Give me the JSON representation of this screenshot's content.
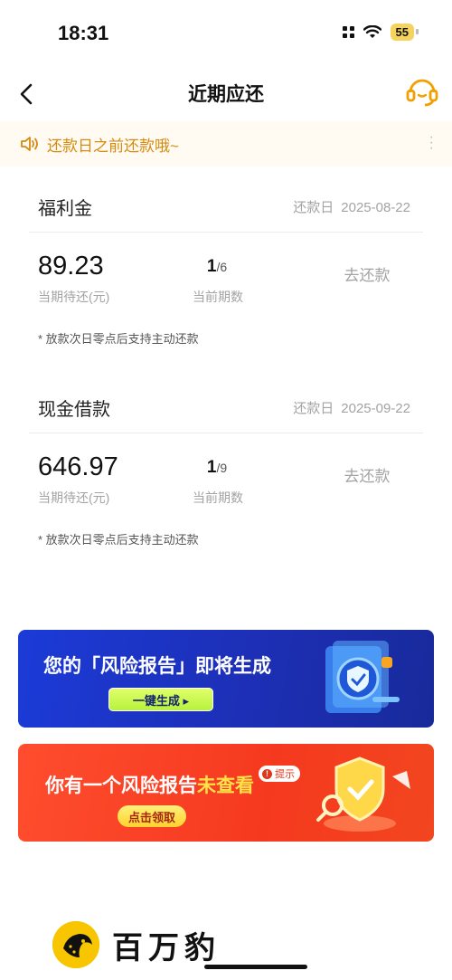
{
  "status_bar": {
    "time": "18:31",
    "battery": "55"
  },
  "nav": {
    "title": "近期应还"
  },
  "notice": {
    "text": "还款日之前还款哦~"
  },
  "loans": [
    {
      "name": "福利金",
      "due_label": "还款日",
      "due_date": "2025-08-22",
      "amount": "89.23",
      "amount_label": "当期待还(元)",
      "period_current": "1",
      "period_total": "/6",
      "period_label": "当前期数",
      "repay_label": "去还款",
      "note": "* 放款次日零点后支持主动还款"
    },
    {
      "name": "现金借款",
      "due_label": "还款日",
      "due_date": "2025-09-22",
      "amount": "646.97",
      "amount_label": "当期待还(元)",
      "period_current": "1",
      "period_total": "/9",
      "period_label": "当前期数",
      "repay_label": "去还款",
      "note": "* 放款次日零点后支持主动还款"
    }
  ],
  "banners": {
    "risk_generate": {
      "title_prefix": "您的",
      "title_highlight": "「风险报告」",
      "title_suffix": "即将生成",
      "button": "一键生成 ▸"
    },
    "risk_unviewed": {
      "title_prefix": "你有一个风险报告",
      "title_highlight": "未查看",
      "badge": "提示",
      "button": "点击领取"
    }
  },
  "brand": {
    "name": "百万豹"
  },
  "colors": {
    "accent": "#f0a000",
    "notice_text": "#d58a12",
    "blue_banner": "#1b3bd8",
    "red_banner": "#f5391f"
  }
}
